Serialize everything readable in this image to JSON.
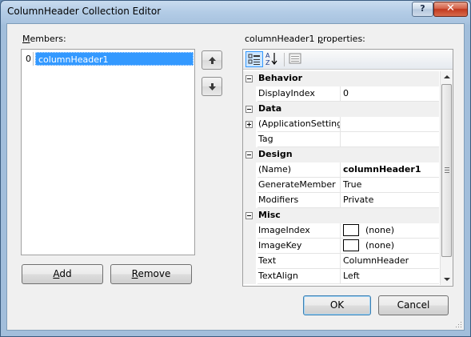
{
  "window": {
    "title": "ColumnHeader Collection Editor",
    "help_label": "?",
    "close_label": "✕"
  },
  "members": {
    "label_prefix": "",
    "label_accel": "M",
    "label_rest": "embers:",
    "items": [
      {
        "index": "0",
        "name": "columnHeader1"
      }
    ],
    "move_up_icon": "up-arrow-icon",
    "move_down_icon": "down-arrow-icon"
  },
  "buttons": {
    "add_accel": "A",
    "add_rest": "dd",
    "remove_accel": "R",
    "remove_rest": "emove",
    "ok": "OK",
    "cancel": "Cancel"
  },
  "properties": {
    "label_prefix": "columnHeader1 ",
    "label_accel": "p",
    "label_rest": "roperties:",
    "toolbar": [
      "categorized-icon",
      "alphabetical-icon",
      "property-pages-icon"
    ],
    "rows": [
      {
        "kind": "category",
        "name": "Behavior",
        "expanded": true
      },
      {
        "kind": "prop",
        "name": "DisplayIndex",
        "value": "0"
      },
      {
        "kind": "category",
        "name": "Data",
        "expanded": true
      },
      {
        "kind": "expandable",
        "name": "(ApplicationSetting",
        "value": ""
      },
      {
        "kind": "prop",
        "name": "Tag",
        "value": ""
      },
      {
        "kind": "category",
        "name": "Design",
        "expanded": true
      },
      {
        "kind": "prop",
        "name": "(Name)",
        "value": "columnHeader1",
        "bold": true
      },
      {
        "kind": "prop",
        "name": "GenerateMember",
        "value": "True"
      },
      {
        "kind": "prop",
        "name": "Modifiers",
        "value": "Private"
      },
      {
        "kind": "category",
        "name": "Misc",
        "expanded": true
      },
      {
        "kind": "prop",
        "name": "ImageIndex",
        "value": "(none)",
        "swatch": true
      },
      {
        "kind": "prop",
        "name": "ImageKey",
        "value": "(none)",
        "swatch": true
      },
      {
        "kind": "prop",
        "name": "Text",
        "value": "ColumnHeader"
      },
      {
        "kind": "prop",
        "name": "TextAlign",
        "value": "Left"
      }
    ]
  }
}
